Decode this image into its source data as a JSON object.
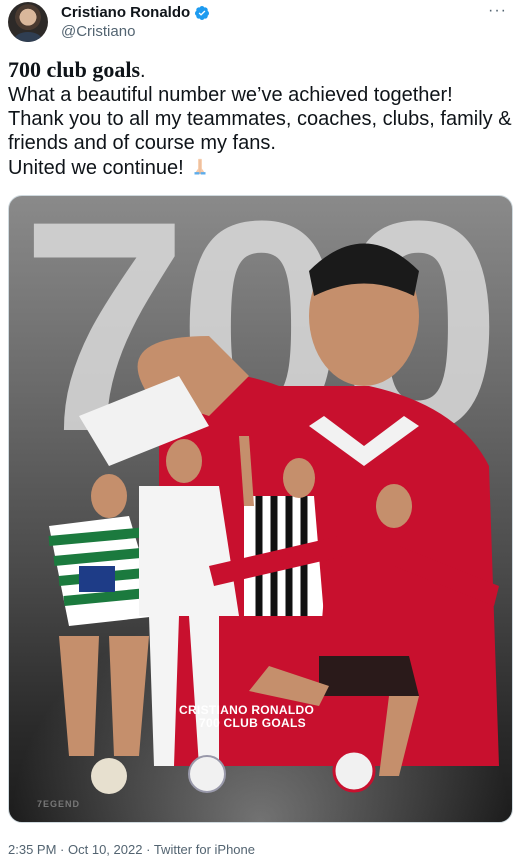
{
  "author": {
    "name": "Cristiano Ronaldo",
    "handle": "@Cristiano",
    "verified": true,
    "avatar_icon": "avatar"
  },
  "menu": {
    "more_label": "···"
  },
  "tweet": {
    "bold_text": "700 club goals",
    "after_bold": ".",
    "body": "What a beautiful number we’ve achieved together!\nThank you to all my teammates, coaches, clubs, family & friends and of course my fans.\nUnited we continue!",
    "emoji_icon": "folded-hands-icon"
  },
  "media": {
    "big_number": "700",
    "caption_line1": "CRISTIANO RONALDO",
    "caption_line2": "700 CLUB GOALS",
    "watermark": "7EGEND",
    "colors": {
      "united_red": "#c8102e",
      "sporting_green": "#1b7a3e"
    }
  },
  "footer": {
    "time": "2:35 PM",
    "date": "Oct 10, 2022",
    "source": "Twitter for iPhone",
    "separator": "·"
  }
}
